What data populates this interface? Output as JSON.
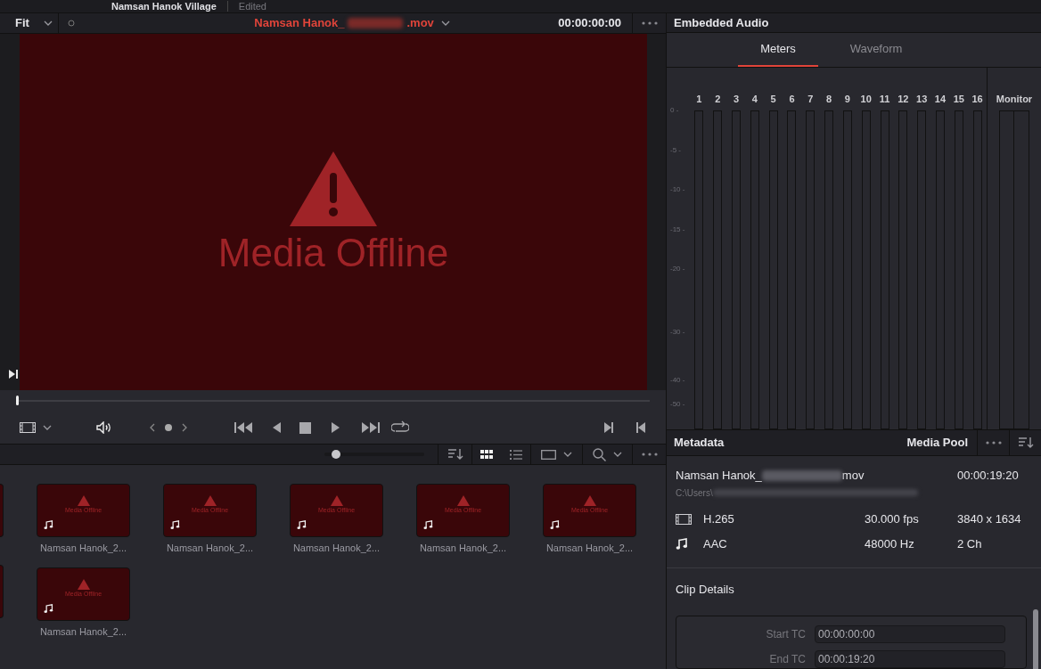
{
  "title_bar": {
    "title": "Namsan Hanok Village",
    "status": "Edited"
  },
  "viewer": {
    "zoom": "Fit",
    "clip_prefix": "Namsan Hanok_",
    "clip_suffix": ".mov",
    "timecode": "00:00:00:00",
    "offline_message": "Media Offline",
    "playhead": {
      "level": 0
    }
  },
  "audio": {
    "title": "Embedded Audio",
    "tabs": [
      {
        "label": "Meters",
        "selected": true
      },
      {
        "label": "Waveform",
        "selected": false
      }
    ],
    "channels": [
      "1",
      "2",
      "3",
      "4",
      "5",
      "6",
      "7",
      "8",
      "9",
      "10",
      "11",
      "12",
      "13",
      "14",
      "15",
      "16"
    ],
    "scale": [
      "0 -",
      "-5 -",
      "-10 -",
      "-15 -",
      "-20 -",
      "-30 -",
      "-40 -",
      "-50 -"
    ],
    "monitor": "Monitor"
  },
  "media_pool": {
    "thumb_size": {
      "level": 0.12
    },
    "grid_view_selected": true,
    "clips": [
      {
        "name": "Namsan Hanok_2...",
        "thumb_text": "Media Offline"
      },
      {
        "name": "Namsan Hanok_2...",
        "thumb_text": "Media Offline"
      },
      {
        "name": "Namsan Hanok_2...",
        "thumb_text": "Media Offline"
      },
      {
        "name": "Namsan Hanok_2...",
        "thumb_text": "Media Offline"
      },
      {
        "name": "Namsan Hanok_2...",
        "thumb_text": "Media Offline"
      },
      {
        "name": "Namsan Hanok_2...",
        "thumb_text": "Media Offline"
      }
    ]
  },
  "metadata": {
    "title": "Metadata",
    "pool_label": "Media Pool",
    "file_prefix": "Namsan Hanok_",
    "file_suffix": "mov",
    "duration": "00:00:19:20",
    "path_prefix": "C:\\Users\\",
    "streams": [
      {
        "kind": "video",
        "codec": "H.265",
        "rate": "30.000 fps",
        "detail": "3840 x 1634"
      },
      {
        "kind": "audio",
        "codec": "AAC",
        "rate": "48000 Hz",
        "detail": "2 Ch"
      }
    ],
    "clip_details": {
      "title": "Clip Details",
      "fields": [
        {
          "label": "Start TC",
          "value": "00:00:00:00"
        },
        {
          "label": "End TC",
          "value": "00:00:19:20"
        }
      ]
    }
  }
}
